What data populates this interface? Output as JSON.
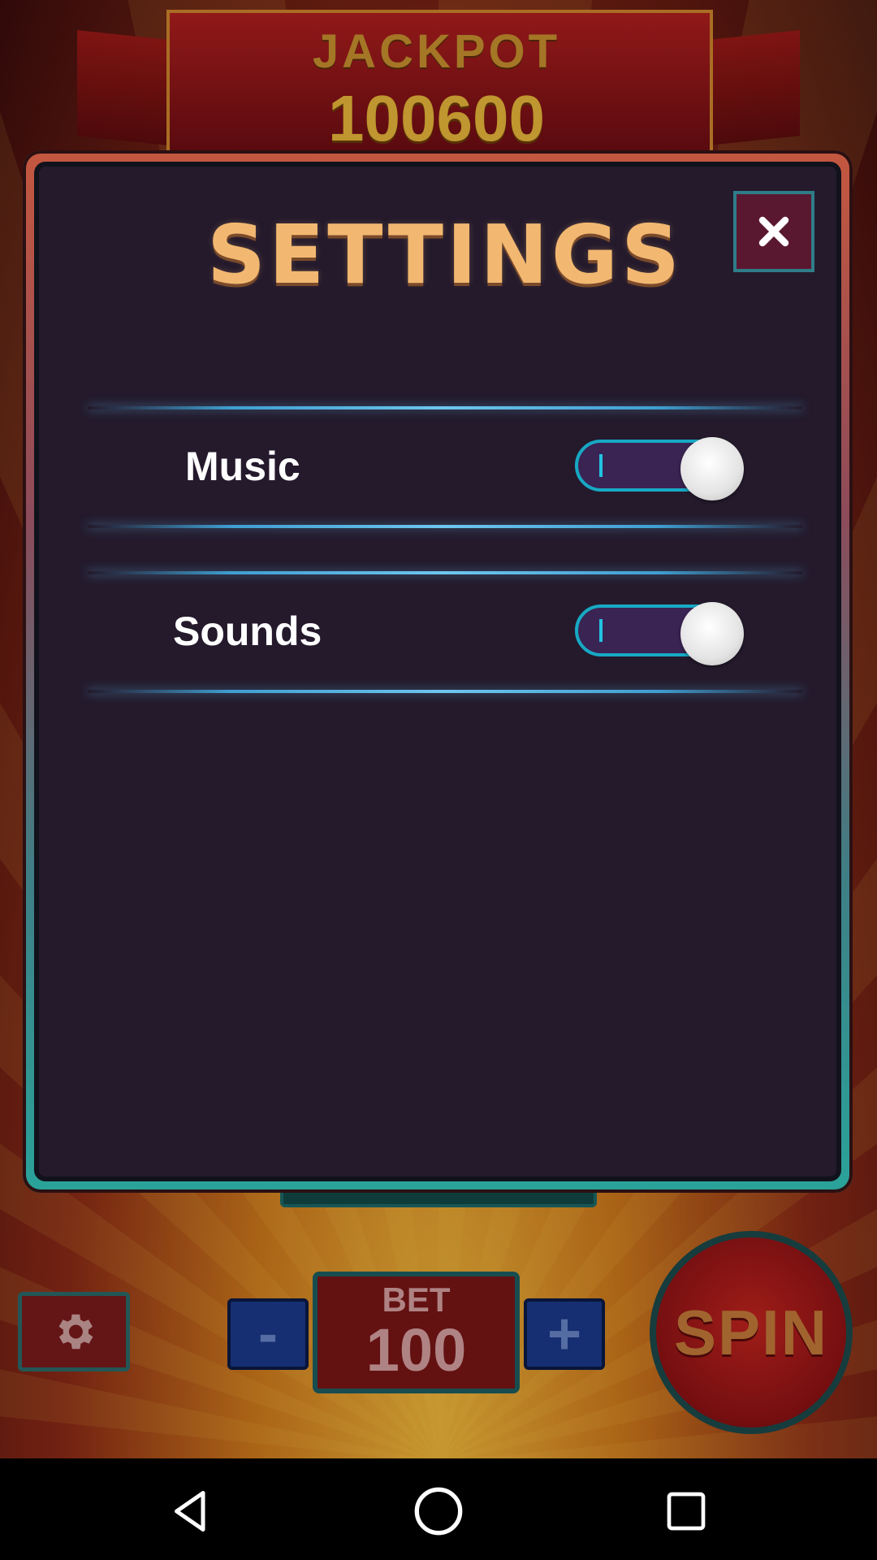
{
  "jackpot": {
    "label": "JACKPOT",
    "value": "100600"
  },
  "dialog": {
    "title": "SETTINGS",
    "close_icon": "close-icon",
    "settings": [
      {
        "label": "Music",
        "enabled": true
      },
      {
        "label": "Sounds",
        "enabled": true
      }
    ]
  },
  "controls": {
    "settings_icon": "gear-icon",
    "bet_label": "BET",
    "bet_value": "100",
    "decrease_label": "-",
    "increase_label": "+",
    "spin_label": "SPIN"
  },
  "navbar": {
    "back_icon": "back-triangle-icon",
    "home_icon": "home-circle-icon",
    "recents_icon": "recents-square-icon"
  },
  "colors": {
    "title_gold": "#f2b871",
    "dialog_bg": "#241a2c",
    "toggle_accent": "#17a9c4",
    "frame_teal": "#2aa39a",
    "frame_red": "#c4573f"
  }
}
